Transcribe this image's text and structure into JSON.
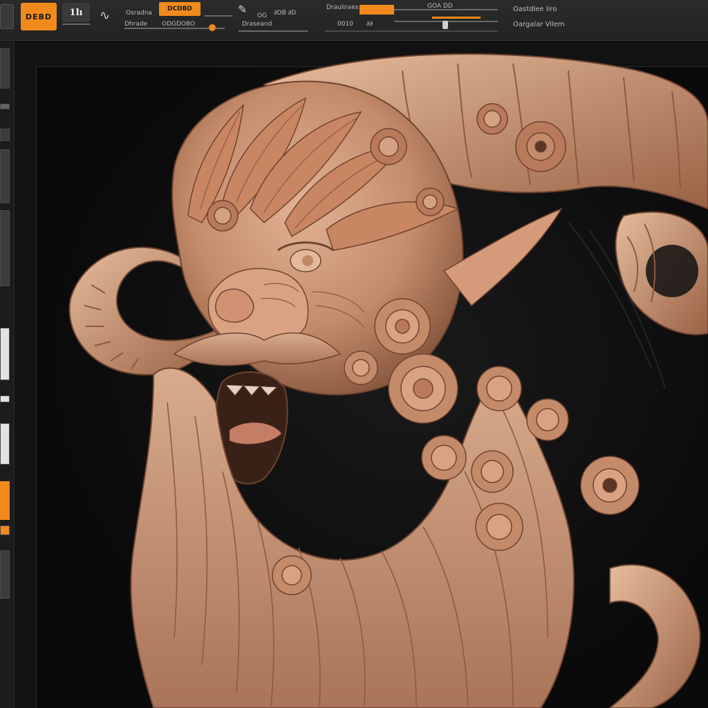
{
  "shelf": {
    "mode_label": "DEBD",
    "brush_label": "1lı",
    "label_a1": "Osradna",
    "label_a2": "Dhrade",
    "label_a3": "ODGDOBO",
    "label_b1": "Draseand",
    "label_b2": "OG",
    "label_b3": "∂DB ∂D",
    "chip_label": "DCDBD",
    "label_c1": "Drauliraes",
    "label_c2": "GOA DD",
    "label_c3": "0010",
    "label_c4": "∂∂",
    "label_d1": "Oastdlee liro",
    "label_d2": "Oargalar Vilem",
    "accent_color": "#f08a1c"
  },
  "canvas": {
    "subject": "sculpted bearded horned creature bust"
  }
}
